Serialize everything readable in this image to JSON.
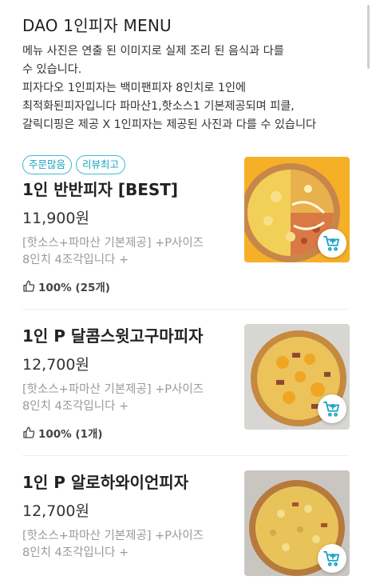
{
  "menu": {
    "title": "DAO 1인피자 MENU",
    "description": "메뉴 사진은 연출 된 이미지로 실제 조리 된 음식과 다를\n수 있습니다.\n피자다오 1인피자는 백미팬피자 8인치로 1인에\n최적화된피자입니다 파마산1,핫소스1 기본제공되며 피클,\n갈릭디핑은 제공 X 1인피자는 제공된 사진과 다를 수 있습니다"
  },
  "colors": {
    "accent": "#1aa3c4",
    "cart_icon": "#1aa3c4",
    "muted": "#9a9a9a"
  },
  "items": [
    {
      "badges": [
        "주문많음",
        "리뷰최고"
      ],
      "name": "1인 반반피자 [BEST]",
      "price": "11,900원",
      "desc": "[핫소스+파마산 기본제공] +P사이즈\n8인치 4조각입니다 +",
      "rating": "100% (25개)",
      "image": "pizza-half-and-half"
    },
    {
      "badges": [],
      "name": "1인 P 달콤스윗고구마피자",
      "price": "12,700원",
      "desc": "[핫소스+파마산 기본제공] +P사이즈\n8인치 4조각입니다 +",
      "rating": "100% (1개)",
      "image": "pizza-sweet-potato"
    },
    {
      "badges": [],
      "name": "1인 P 알로하와이언피자",
      "price": "12,700원",
      "desc": "[핫소스+파마산 기본제공] +P사이즈\n8인치 4조각입니다 +",
      "rating": "",
      "image": "pizza-hawaiian"
    }
  ]
}
